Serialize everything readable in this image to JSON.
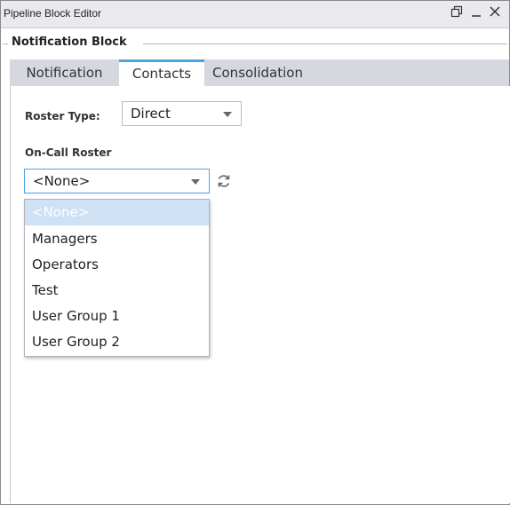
{
  "window": {
    "title": "Pipeline Block Editor"
  },
  "titlebar_icons": [
    "restore-icon",
    "minimize-icon",
    "close-icon"
  ],
  "group": {
    "title": "Notification Block"
  },
  "tabs": [
    {
      "label": "Notification",
      "active": false
    },
    {
      "label": "Contacts",
      "active": true
    },
    {
      "label": "Consolidation",
      "active": false
    }
  ],
  "roster_type": {
    "label": "Roster Type:",
    "value": "Direct"
  },
  "on_call_roster": {
    "label": "On-Call Roster",
    "value": "<None>",
    "options": [
      "<None>",
      "Managers",
      "Operators",
      "Test",
      "User Group 1",
      "User Group 2"
    ],
    "selected_index": 0
  },
  "colors": {
    "accent": "#4aa3df",
    "tab_bg": "#d6d8df",
    "selected_option_bg": "#cfe1f4"
  }
}
